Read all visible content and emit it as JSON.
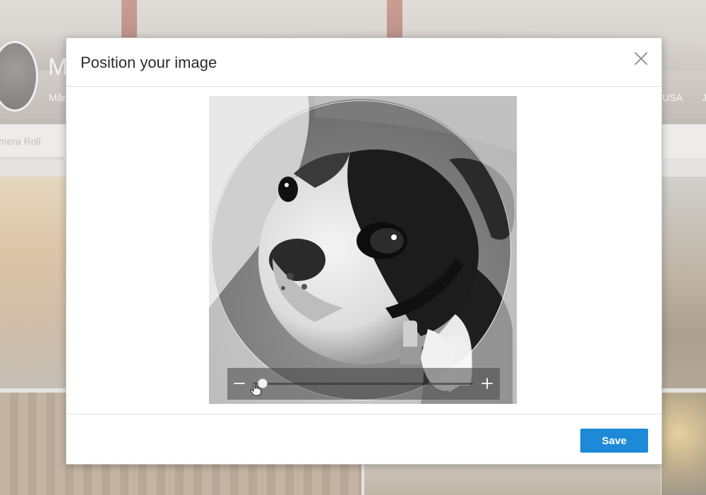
{
  "background": {
    "profile_name_initial": "M",
    "profile_sub": "Mår",
    "location": "USA",
    "location_trailing": "J",
    "tab_label": "mera Roll"
  },
  "modal": {
    "title": "Position your image",
    "close_icon": "close-icon",
    "save_label": "Save"
  },
  "zoom": {
    "minus_icon": "minus-icon",
    "plus_icon": "plus-icon",
    "level": 0.04
  },
  "colors": {
    "accent": "#1d8ad8",
    "modal_bg": "#ffffff"
  }
}
